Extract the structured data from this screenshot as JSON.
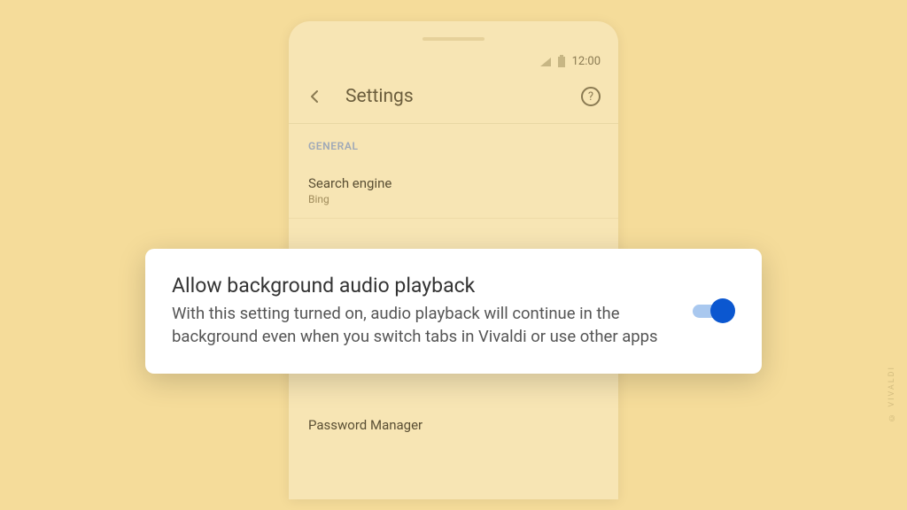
{
  "statusBar": {
    "time": "12:00"
  },
  "header": {
    "title": "Settings"
  },
  "sections": {
    "general": {
      "label": "GENERAL",
      "searchEngine": {
        "title": "Search engine",
        "value": "Bing"
      },
      "passwordManager": {
        "title": "Password Manager"
      }
    }
  },
  "popup": {
    "title": "Allow background audio playback",
    "description": "With this setting turned on, audio playback will continue in the background even when you switch tabs in Vivaldi or use other apps",
    "enabled": true
  },
  "watermark": "© VIVALDI"
}
